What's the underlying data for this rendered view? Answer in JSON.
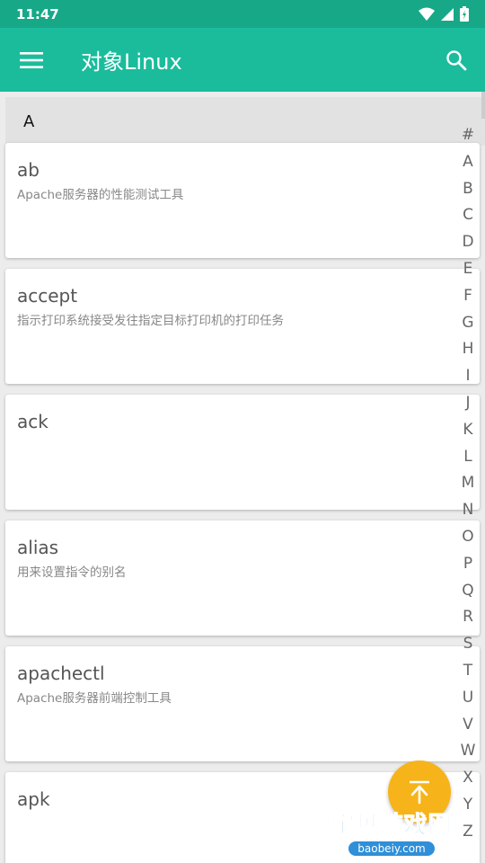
{
  "status_bar": {
    "time": "11:47"
  },
  "app_bar": {
    "title": "对象Linux"
  },
  "section": {
    "letter": "A"
  },
  "commands": [
    {
      "name": "ab",
      "desc": "Apache服务器的性能测试工具"
    },
    {
      "name": "accept",
      "desc": "指示打印系统接受发往指定目标打印机的打印任务"
    },
    {
      "name": "ack",
      "desc": ""
    },
    {
      "name": "alias",
      "desc": "用来设置指令的别名"
    },
    {
      "name": "apachectl",
      "desc": "Apache服务器前端控制工具"
    },
    {
      "name": "apk",
      "desc": ""
    }
  ],
  "index_letters": [
    "#",
    "A",
    "B",
    "C",
    "D",
    "E",
    "F",
    "G",
    "H",
    "I",
    "J",
    "K",
    "L",
    "M",
    "N",
    "O",
    "P",
    "Q",
    "R",
    "S",
    "T",
    "U",
    "V",
    "W",
    "X",
    "Y",
    "Z"
  ],
  "watermark": {
    "text": "宝贝游戏网",
    "url": "baobeiy.com"
  },
  "colors": {
    "primary": "#1abc9c",
    "status": "#17a888",
    "fab": "#f6b41a"
  }
}
